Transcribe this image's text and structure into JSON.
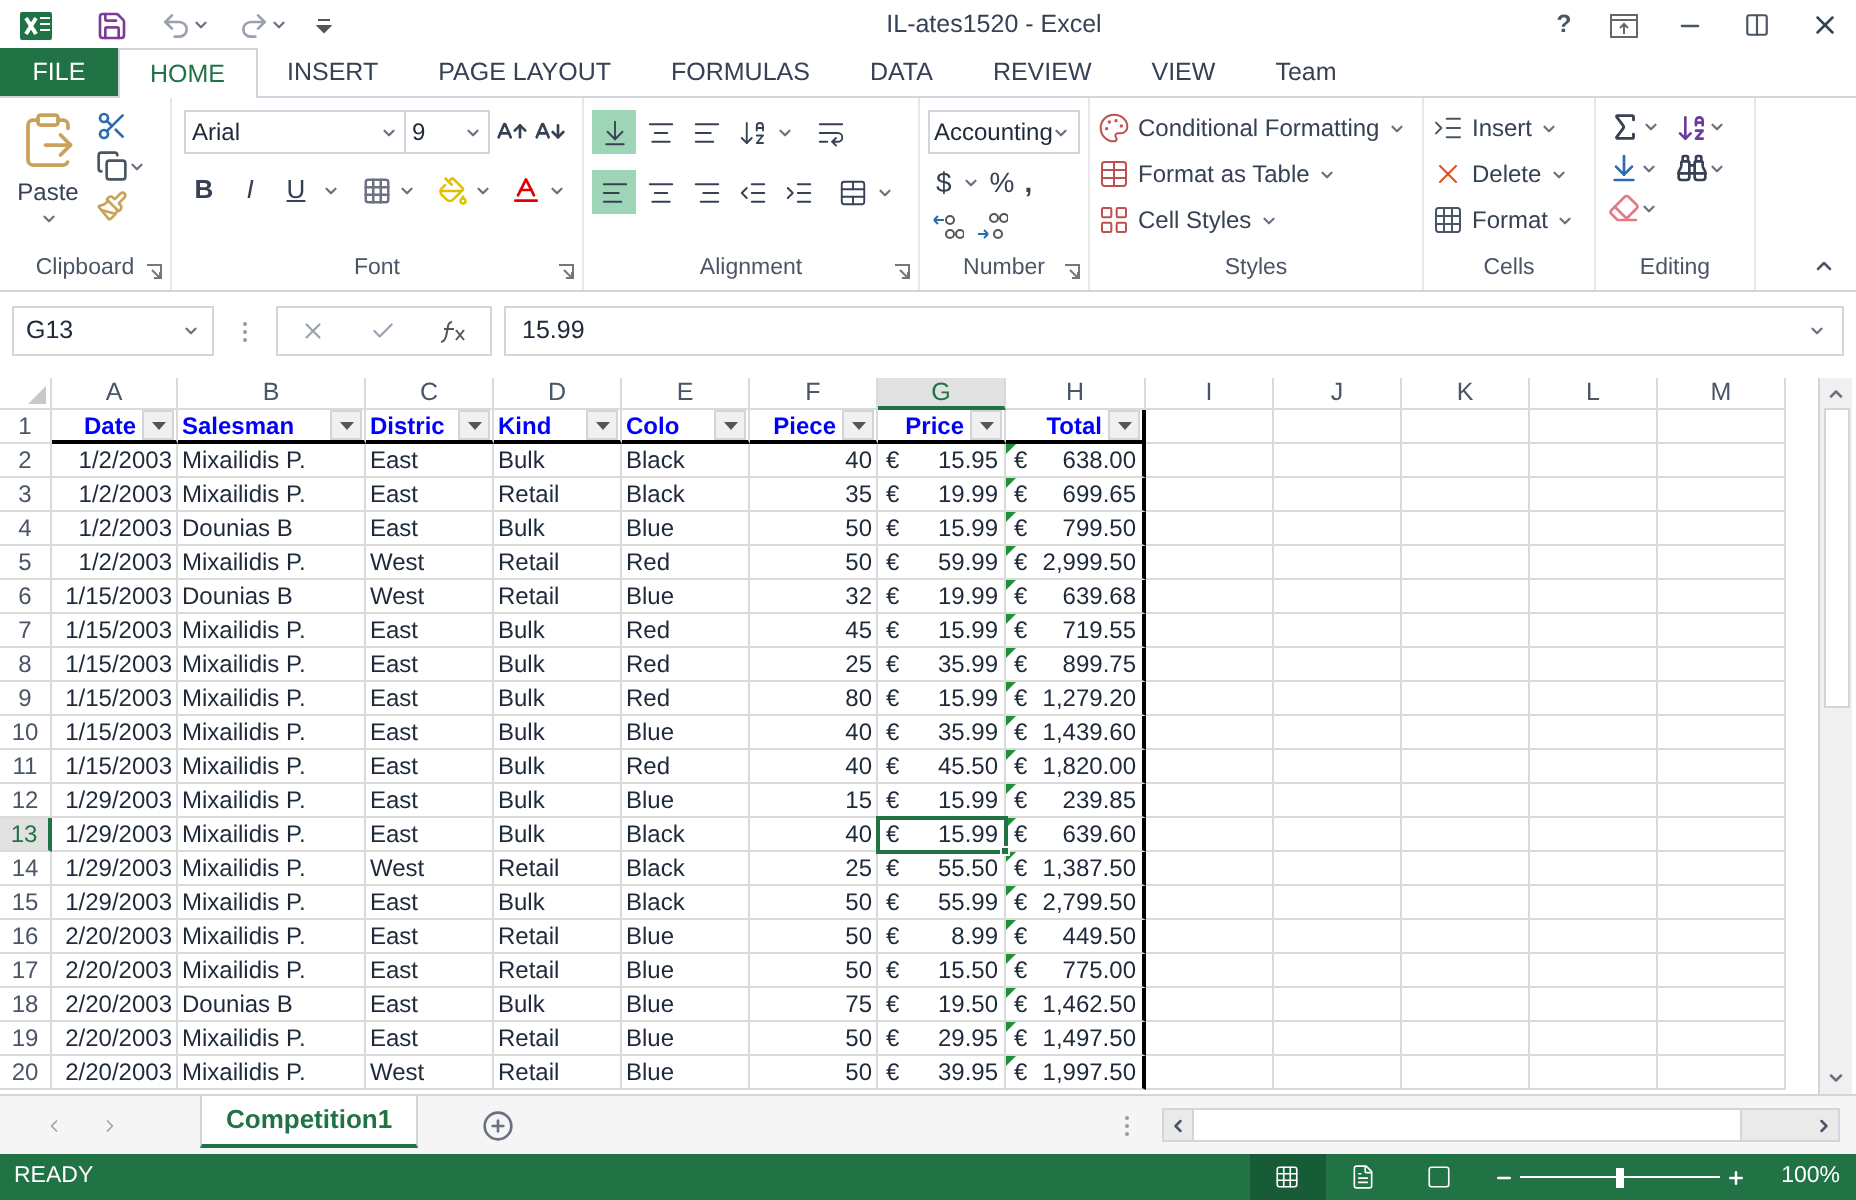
{
  "window": {
    "title": "IL-ates1520 - Excel",
    "help": "?"
  },
  "tabs": [
    {
      "label": "FILE",
      "kind": "file",
      "selected": false
    },
    {
      "label": "HOME",
      "kind": "tab",
      "selected": true
    },
    {
      "label": "INSERT",
      "kind": "tab",
      "selected": false
    },
    {
      "label": "PAGE LAYOUT",
      "kind": "tab",
      "selected": false
    },
    {
      "label": "FORMULAS",
      "kind": "tab",
      "selected": false
    },
    {
      "label": "DATA",
      "kind": "tab",
      "selected": false
    },
    {
      "label": "REVIEW",
      "kind": "tab",
      "selected": false
    },
    {
      "label": "VIEW",
      "kind": "tab",
      "selected": false
    },
    {
      "label": "Team",
      "kind": "tab",
      "selected": false
    }
  ],
  "ribbon": {
    "paste": "Paste",
    "font_name": "Arial",
    "font_size": "9",
    "font_styles": [
      "B",
      "I",
      "U"
    ],
    "vertical_align": [
      {
        "selected": true
      },
      {
        "selected": false
      },
      {
        "selected": false
      }
    ],
    "horizontal_align": [
      {
        "selected": true
      },
      {
        "selected": false
      },
      {
        "selected": false
      }
    ],
    "number_format": "Accounting",
    "number_symbols": [
      "$",
      "%",
      ","
    ],
    "styles": [
      "Conditional Formatting",
      "Format as Table",
      "Cell Styles"
    ],
    "cells": [
      "Insert",
      "Delete",
      "Format"
    ],
    "groups": [
      "Clipboard",
      "Font",
      "Alignment",
      "Number",
      "Styles",
      "Cells",
      "Editing"
    ]
  },
  "formula_bar": {
    "name_box": "G13",
    "formula": "15.99"
  },
  "sheet": {
    "columns": [
      {
        "letter": "A",
        "selected": false
      },
      {
        "letter": "B",
        "selected": false
      },
      {
        "letter": "C",
        "selected": false
      },
      {
        "letter": "D",
        "selected": false
      },
      {
        "letter": "E",
        "selected": false
      },
      {
        "letter": "F",
        "selected": false
      },
      {
        "letter": "G",
        "selected": true
      },
      {
        "letter": "H",
        "selected": false,
        "flagged": true
      },
      {
        "letter": "I",
        "selected": false
      },
      {
        "letter": "J",
        "selected": false
      },
      {
        "letter": "K",
        "selected": false
      },
      {
        "letter": "L",
        "selected": false
      },
      {
        "letter": "M",
        "selected": false
      }
    ],
    "header": {
      "row": "1",
      "selected": false,
      "fields": [
        {
          "label": "Date",
          "kind": "date"
        },
        {
          "label": "Salesman",
          "kind": "text"
        },
        {
          "label": "Distric",
          "kind": "text"
        },
        {
          "label": "Kind",
          "kind": "text"
        },
        {
          "label": "Colo",
          "kind": "text"
        },
        {
          "label": "Piece",
          "kind": "number"
        },
        {
          "label": "Price",
          "kind": "money"
        },
        {
          "label": "Total",
          "kind": "money"
        }
      ]
    },
    "rows": [
      {
        "row": "2",
        "selected": false,
        "values": [
          "1/2/2003",
          "Mixailidis P.",
          "East",
          "Bulk",
          "Black",
          "40",
          [
            "€",
            "15.95"
          ],
          [
            "€",
            "638.00"
          ]
        ]
      },
      {
        "row": "3",
        "selected": false,
        "values": [
          "1/2/2003",
          "Mixailidis P.",
          "East",
          "Retail",
          "Black",
          "35",
          [
            "€",
            "19.99"
          ],
          [
            "€",
            "699.65"
          ]
        ]
      },
      {
        "row": "4",
        "selected": false,
        "values": [
          "1/2/2003",
          "Dounias B",
          "East",
          "Bulk",
          "Blue",
          "50",
          [
            "€",
            "15.99"
          ],
          [
            "€",
            "799.50"
          ]
        ]
      },
      {
        "row": "5",
        "selected": false,
        "values": [
          "1/2/2003",
          "Mixailidis P.",
          "West",
          "Retail",
          "Red",
          "50",
          [
            "€",
            "59.99"
          ],
          [
            "€",
            "2,999.50"
          ]
        ]
      },
      {
        "row": "6",
        "selected": false,
        "values": [
          "1/15/2003",
          "Dounias B",
          "West",
          "Retail",
          "Blue",
          "32",
          [
            "€",
            "19.99"
          ],
          [
            "€",
            "639.68"
          ]
        ]
      },
      {
        "row": "7",
        "selected": false,
        "values": [
          "1/15/2003",
          "Mixailidis P.",
          "East",
          "Bulk",
          "Red",
          "45",
          [
            "€",
            "15.99"
          ],
          [
            "€",
            "719.55"
          ]
        ]
      },
      {
        "row": "8",
        "selected": false,
        "values": [
          "1/15/2003",
          "Mixailidis P.",
          "East",
          "Bulk",
          "Red",
          "25",
          [
            "€",
            "35.99"
          ],
          [
            "€",
            "899.75"
          ]
        ]
      },
      {
        "row": "9",
        "selected": false,
        "values": [
          "1/15/2003",
          "Mixailidis P.",
          "East",
          "Bulk",
          "Red",
          "80",
          [
            "€",
            "15.99"
          ],
          [
            "€",
            "1,279.20"
          ]
        ]
      },
      {
        "row": "10",
        "selected": false,
        "values": [
          "1/15/2003",
          "Mixailidis P.",
          "East",
          "Bulk",
          "Blue",
          "40",
          [
            "€",
            "35.99"
          ],
          [
            "€",
            "1,439.60"
          ]
        ]
      },
      {
        "row": "11",
        "selected": false,
        "values": [
          "1/15/2003",
          "Mixailidis P.",
          "East",
          "Bulk",
          "Red",
          "40",
          [
            "€",
            "45.50"
          ],
          [
            "€",
            "1,820.00"
          ]
        ]
      },
      {
        "row": "12",
        "selected": false,
        "values": [
          "1/29/2003",
          "Mixailidis P.",
          "East",
          "Bulk",
          "Blue",
          "15",
          [
            "€",
            "15.99"
          ],
          [
            "€",
            "239.85"
          ]
        ]
      },
      {
        "row": "13",
        "selected": true,
        "values": [
          "1/29/2003",
          "Mixailidis P.",
          "East",
          "Bulk",
          "Black",
          "40",
          [
            "€",
            "15.99"
          ],
          [
            "€",
            "639.60"
          ]
        ]
      },
      {
        "row": "14",
        "selected": false,
        "values": [
          "1/29/2003",
          "Mixailidis P.",
          "West",
          "Retail",
          "Black",
          "25",
          [
            "€",
            "55.50"
          ],
          [
            "€",
            "1,387.50"
          ]
        ]
      },
      {
        "row": "15",
        "selected": false,
        "values": [
          "1/29/2003",
          "Mixailidis P.",
          "East",
          "Bulk",
          "Black",
          "50",
          [
            "€",
            "55.99"
          ],
          [
            "€",
            "2,799.50"
          ]
        ]
      },
      {
        "row": "16",
        "selected": false,
        "values": [
          "2/20/2003",
          "Mixailidis P.",
          "East",
          "Retail",
          "Blue",
          "50",
          [
            "€",
            "8.99"
          ],
          [
            "€",
            "449.50"
          ]
        ]
      },
      {
        "row": "17",
        "selected": false,
        "values": [
          "2/20/2003",
          "Mixailidis P.",
          "East",
          "Retail",
          "Blue",
          "50",
          [
            "€",
            "15.50"
          ],
          [
            "€",
            "775.00"
          ]
        ]
      },
      {
        "row": "18",
        "selected": false,
        "values": [
          "2/20/2003",
          "Dounias B",
          "East",
          "Bulk",
          "Blue",
          "75",
          [
            "€",
            "19.50"
          ],
          [
            "€",
            "1,462.50"
          ]
        ]
      },
      {
        "row": "19",
        "selected": false,
        "values": [
          "2/20/2003",
          "Mixailidis P.",
          "East",
          "Retail",
          "Blue",
          "50",
          [
            "€",
            "29.95"
          ],
          [
            "€",
            "1,497.50"
          ]
        ]
      },
      {
        "row": "20",
        "selected": false,
        "values": [
          "2/20/2003",
          "Mixailidis P.",
          "West",
          "Retail",
          "Blue",
          "50",
          [
            "€",
            "39.95"
          ],
          [
            "€",
            "1,997.50"
          ]
        ]
      }
    ]
  },
  "sheet_tabs": [
    {
      "label": "Competition1",
      "selected": true
    }
  ],
  "status_bar": {
    "status": "READY",
    "views": [
      {
        "selected": true
      },
      {
        "selected": false
      },
      {
        "selected": false
      }
    ],
    "zoom": {
      "level": 0.5,
      "reading": "100%"
    }
  }
}
